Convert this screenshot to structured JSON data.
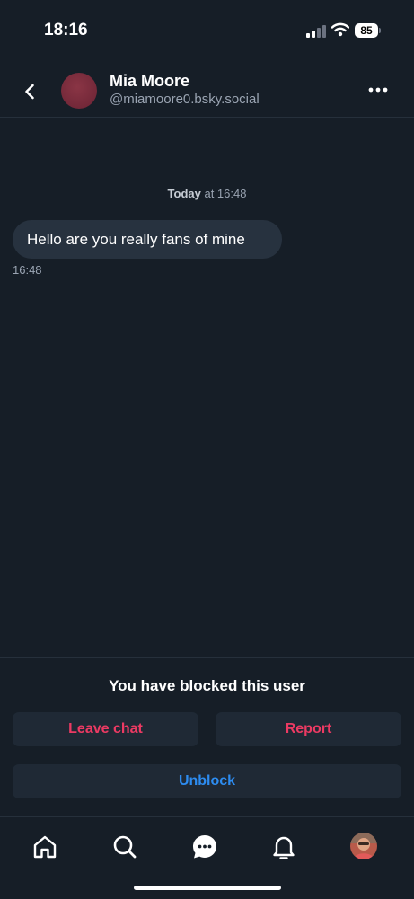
{
  "status_bar": {
    "time": "18:16",
    "battery": "85"
  },
  "header": {
    "name": "Mia Moore",
    "handle": "@miamoore0.bsky.social",
    "back_icon": "chevron-left-icon",
    "more_icon": "ellipsis-icon"
  },
  "conversation": {
    "date_separator": {
      "day": "Today",
      "rest": " at 16:48"
    },
    "messages": [
      {
        "text": "Hello are you really fans of mine",
        "time": "16:48"
      }
    ]
  },
  "blocked": {
    "notice": "You have blocked this user",
    "leave_label": "Leave chat",
    "report_label": "Report",
    "unblock_label": "Unblock"
  },
  "tabs": [
    {
      "name": "home",
      "icon": "home-icon"
    },
    {
      "name": "search",
      "icon": "search-icon"
    },
    {
      "name": "messages",
      "icon": "chat-icon"
    },
    {
      "name": "notifications",
      "icon": "bell-icon"
    },
    {
      "name": "profile",
      "icon": "avatar"
    }
  ],
  "colors": {
    "background": "#161e27",
    "bubble": "#27323f",
    "danger": "#ec3a63",
    "accent": "#2d8cf0"
  }
}
